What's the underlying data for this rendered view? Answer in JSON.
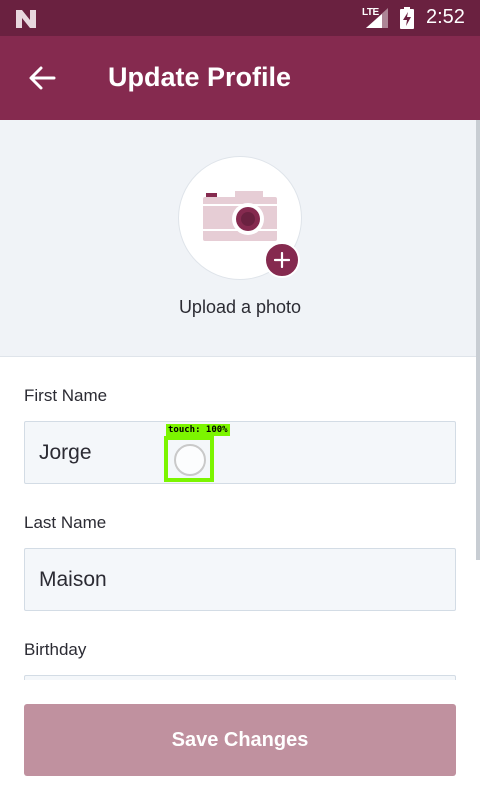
{
  "status_bar": {
    "network_label": "LTE",
    "time": "2:52",
    "icons": [
      "n-logo-icon",
      "signal-icon",
      "battery-charging-icon"
    ]
  },
  "header": {
    "title": "Update Profile",
    "back_icon": "arrow-left-icon"
  },
  "photo": {
    "icon": "camera-icon",
    "add_icon": "plus-icon",
    "label": "Upload a photo"
  },
  "form": {
    "first_name": {
      "label": "First Name",
      "value": "Jorge"
    },
    "last_name": {
      "label": "Last Name",
      "value": "Maison"
    },
    "birthday": {
      "label": "Birthday",
      "value": ""
    }
  },
  "touch_overlay": {
    "label": "touch: 100%"
  },
  "actions": {
    "save_label": "Save Changes"
  },
  "colors": {
    "status_bar": "#6a2140",
    "app_bar": "#852a4f",
    "accent": "#852a4f",
    "save_button": "#c0919f",
    "photo_background": "#f0f3f7",
    "input_background": "#f4f7fa",
    "touch_overlay": "#7cf500"
  }
}
